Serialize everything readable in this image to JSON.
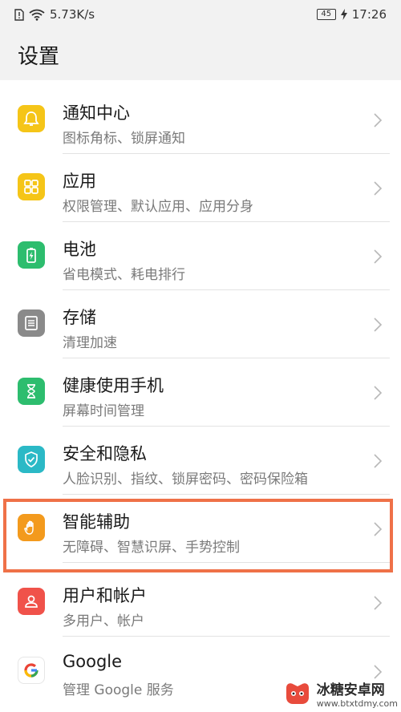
{
  "status_bar": {
    "speed": "5.73K/s",
    "battery": "45",
    "time": "17:26"
  },
  "header": {
    "title": "设置"
  },
  "items": [
    {
      "title": "通知中心",
      "subtitle": "图标角标、锁屏通知",
      "icon": "bell-icon",
      "color": "#f5c518"
    },
    {
      "title": "应用",
      "subtitle": "权限管理、默认应用、应用分身",
      "icon": "apps-grid-icon",
      "color": "#f5c518"
    },
    {
      "title": "电池",
      "subtitle": "省电模式、耗电排行",
      "icon": "battery-icon",
      "color": "#2dbd6e"
    },
    {
      "title": "存储",
      "subtitle": "清理加速",
      "icon": "storage-icon",
      "color": "#8a8a8a"
    },
    {
      "title": "健康使用手机",
      "subtitle": "屏幕时间管理",
      "icon": "hourglass-icon",
      "color": "#2dbd6e"
    },
    {
      "title": "安全和隐私",
      "subtitle": "人脸识别、指纹、锁屏密码、密码保险箱",
      "icon": "shield-icon",
      "color": "#2bb9c6"
    },
    {
      "title": "智能辅助",
      "subtitle": "无障碍、智慧识屏、手势控制",
      "icon": "hand-icon",
      "color": "#f39a1d"
    },
    {
      "title": "用户和帐户",
      "subtitle": "多用户、帐户",
      "icon": "user-icon",
      "color": "#f0524a"
    },
    {
      "title": "Google",
      "subtitle": "管理 Google 服务",
      "icon": "google-icon",
      "color": "#ea4335"
    }
  ],
  "highlight_color": "#ef7148",
  "watermark": {
    "name": "冰糖安卓网",
    "url": "www.btxtdmy.com"
  }
}
